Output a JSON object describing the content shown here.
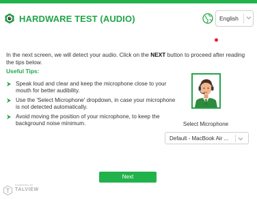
{
  "header": {
    "title": "HARDWARE TEST (AUDIO)",
    "language": "English"
  },
  "intro": {
    "before": "In the next screen, we will detect your audio. Click on the ",
    "bold": "NEXT",
    "after": " button to proceed after reading the tips below."
  },
  "tips": {
    "title": "Useful Tips:",
    "items": [
      "Speak loud and clear and keep the microphone close to your mouth for better audibility.",
      "Use the 'Select Microphone' dropdown, in case your microphone is not detected automatically.",
      "Avoid moving the position of your microphone, to keep the background noise minimum."
    ]
  },
  "microphone": {
    "label": "Select Microphone",
    "selected": "Default - MacBook Air ..."
  },
  "footer": {
    "next_label": "Next",
    "powered_by": "POWERED BY",
    "brand": "TALVIEW"
  },
  "colors": {
    "accent": "#22a447",
    "top_bar": "#22b24c",
    "record_dot": "#e21f26"
  },
  "icons": {
    "logo": "camera-lens-logo-icon",
    "language": "globe-icon",
    "chevron": "chevron-down-icon",
    "tip_bullet": "arrow-right-icon",
    "status": "record-dot-icon"
  }
}
